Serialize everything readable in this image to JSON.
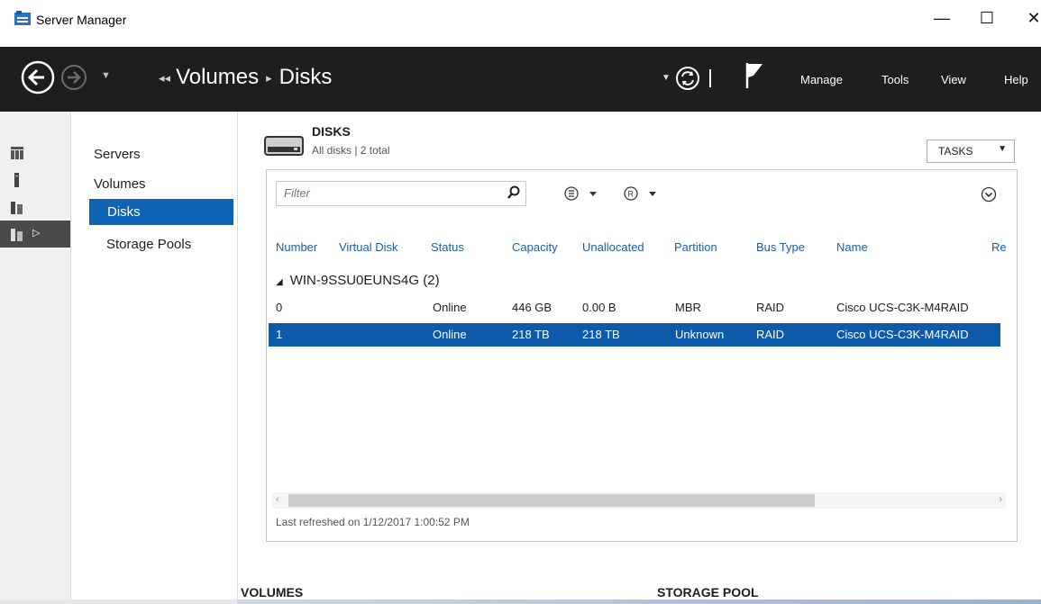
{
  "window": {
    "title": "Server Manager",
    "controls": {
      "minimize": "—",
      "maximize": "☐",
      "close": "✕"
    }
  },
  "command_bar": {
    "breadcrumb": {
      "lead": "◂◂",
      "parent": "Volumes",
      "separator": "▸",
      "current": "Disks"
    },
    "menu": [
      "Manage",
      "Tools",
      "View",
      "Help"
    ]
  },
  "nav": {
    "items": [
      "Servers",
      "Volumes",
      "Disks",
      "Storage Pools"
    ],
    "selected": "Disks"
  },
  "disks_tile": {
    "title": "DISKS",
    "subtitle": "All disks | 2 total",
    "tasks_label": "TASKS",
    "filter_placeholder": "Filter",
    "columns": [
      "Number",
      "Virtual Disk",
      "Status",
      "Capacity",
      "Unallocated",
      "Partition",
      "Bus Type",
      "Name",
      "Re"
    ],
    "group": "WIN-9SSU0EUNS4G (2)",
    "group_arrow": "◢",
    "rows": [
      {
        "number": "0",
        "virtual_disk": "",
        "status": "Online",
        "capacity": "446 GB",
        "unallocated": "0.00 B",
        "partition": "MBR",
        "bus_type": "RAID",
        "name": "Cisco UCS-C3K-M4RAID",
        "selected": false
      },
      {
        "number": "1",
        "virtual_disk": "",
        "status": "Online",
        "capacity": "218 TB",
        "unallocated": "218 TB",
        "partition": "Unknown",
        "bus_type": "RAID",
        "name": "Cisco UCS-C3K-M4RAID",
        "selected": true
      }
    ],
    "last_refreshed": "Last refreshed on 1/12/2017 1:00:52 PM"
  },
  "bottom": {
    "volumes_title": "VOLUMES",
    "storage_pool_title": "STORAGE POOL"
  },
  "colors": {
    "selection": "#0e5aaa",
    "command_bar": "#1e1e1e",
    "header_text": "#1a5ea8"
  }
}
